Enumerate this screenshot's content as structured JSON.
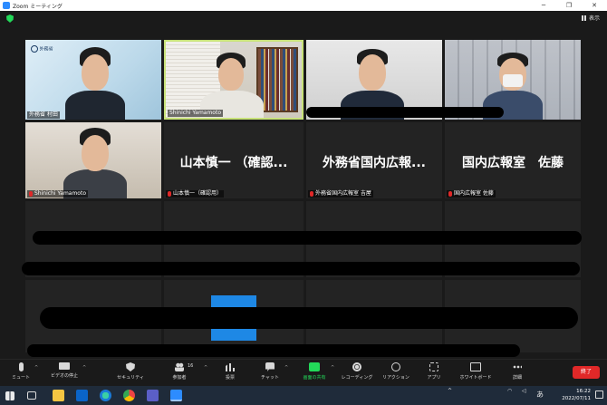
{
  "window": {
    "title": "Zoom ミーティング",
    "controls": [
      "─",
      "❐",
      "✕"
    ]
  },
  "meeting": {
    "view_label": "表示"
  },
  "participants": [
    {
      "name": "外務省 村田",
      "muted": false
    },
    {
      "name": "Shinichi Yamamoto",
      "muted": false
    },
    {
      "name": "",
      "muted": false
    },
    {
      "name": "",
      "muted": false
    },
    {
      "name": "Shinichi Yamamoto",
      "muted": true
    },
    {
      "name": "山本慎一（確認用）",
      "display": "山本慎一 （確認...",
      "muted": true
    },
    {
      "name": "外務省国内広報室 吉屋",
      "display": "外務省国内広報...",
      "muted": true
    },
    {
      "name": "国内広報室 佐藤",
      "display": "国内広報室　佐藤",
      "muted": true
    }
  ],
  "logo_text": "外務省",
  "toolbar": {
    "mute": "ミュート",
    "video": "ビデオの停止",
    "security": "セキュリティ",
    "participants": "参加者",
    "participants_count": "16",
    "polls": "投票",
    "chat": "チャット",
    "share": "画面の共有",
    "record": "レコーディング",
    "reactions": "リアクション",
    "apps": "アプリ",
    "whiteboard": "ホワイトボード",
    "more": "詳細",
    "end": "終了"
  },
  "taskbar": {
    "ime": "あ",
    "time": "16:22",
    "date": "2022/07/11"
  },
  "colors": {
    "zoom_blue": "#2d8cff",
    "end_red": "#e02828",
    "share_green": "#23d959",
    "active_speaker": "#c8e27a"
  }
}
